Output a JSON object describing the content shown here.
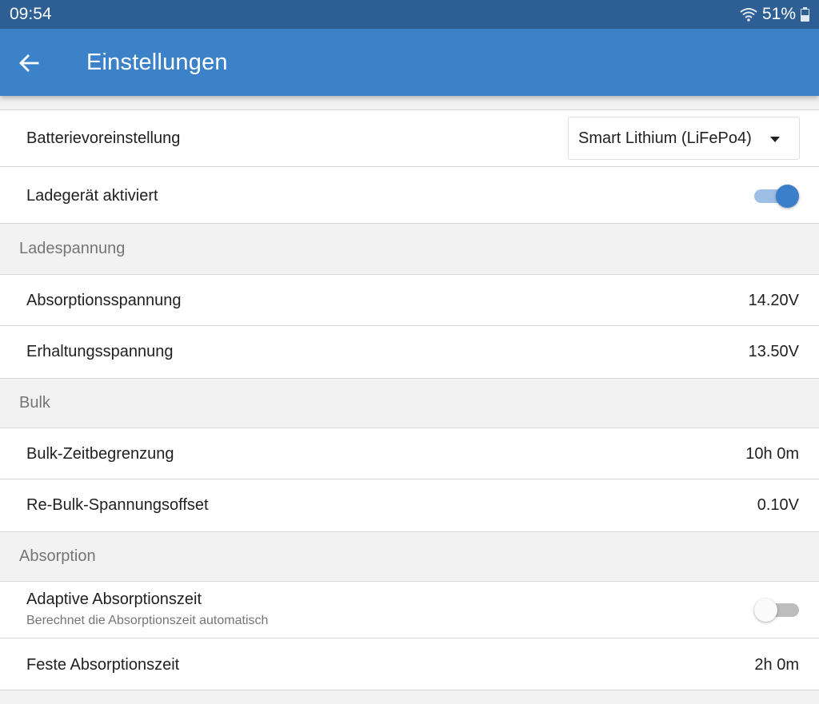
{
  "status_bar": {
    "time": "09:54",
    "battery": "51%"
  },
  "app_bar": {
    "title": "Einstellungen"
  },
  "settings": {
    "battery_preset": {
      "label": "Batterievoreinstellung",
      "value": "Smart Lithium (LiFePo4)"
    },
    "charger_enabled": {
      "label": "Ladegerät aktiviert",
      "on": true
    },
    "section_charge_voltage": "Ladespannung",
    "absorption_voltage": {
      "label": "Absorptionsspannung",
      "value": "14.20V"
    },
    "float_voltage": {
      "label": "Erhaltungsspannung",
      "value": "13.50V"
    },
    "section_bulk": "Bulk",
    "bulk_time_limit": {
      "label": "Bulk-Zeitbegrenzung",
      "value": "10h 0m"
    },
    "rebulk_offset": {
      "label": "Re-Bulk-Spannungsoffset",
      "value": "0.10V"
    },
    "section_absorption": "Absorption",
    "adaptive_absorption": {
      "label": "Adaptive Absorptionszeit",
      "description": "Berechnet die Absorptionszeit automatisch",
      "on": false
    },
    "fixed_absorption": {
      "label": "Feste Absorptionszeit",
      "value": "2h 0m"
    }
  },
  "colors": {
    "status_bar": "#2e5f94",
    "app_bar": "#3b82c8",
    "accent": "#3b7fcb"
  },
  "icons": [
    "wifi-icon",
    "battery-icon",
    "back-arrow-icon",
    "dropdown-arrow-icon"
  ]
}
